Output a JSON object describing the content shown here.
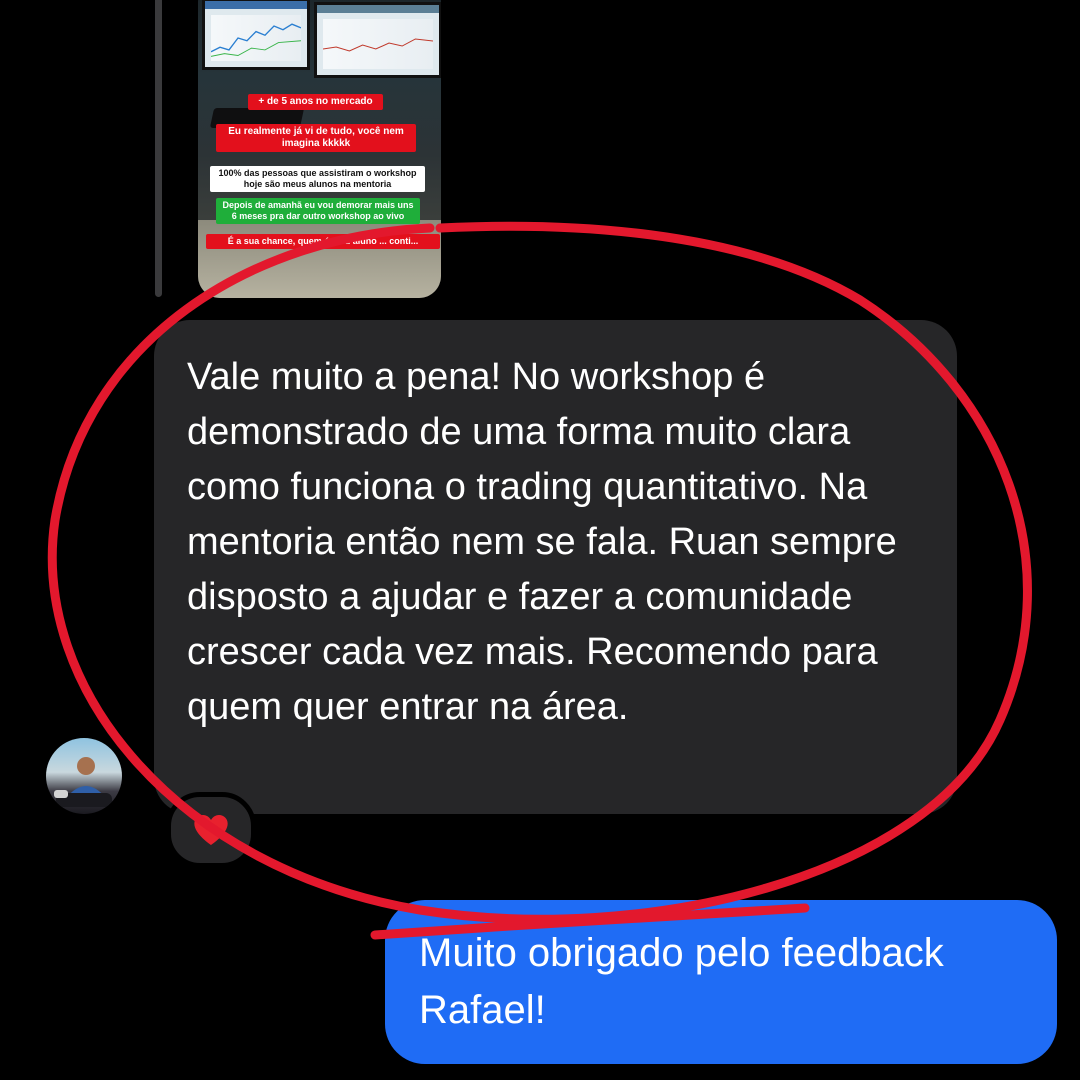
{
  "thread": {
    "story_preview": {
      "labels": [
        {
          "text": "+ de 5 anos no mercado",
          "style": "red"
        },
        {
          "text": "Eu realmente já vi de tudo, você nem imagina kkkkk",
          "style": "red"
        },
        {
          "text": "100% das pessoas que assistiram o workshop hoje são meus alunos na mentoria",
          "style": "white"
        },
        {
          "text": "Depois de amanhã eu vou demorar mais uns 6 meses pra dar outro workshop ao vivo",
          "style": "green"
        },
        {
          "text": "É a sua chance, quem é meu aluno ... conti...",
          "style": "red"
        }
      ]
    },
    "incoming_message": {
      "text": "Vale muito a pena! No workshop é demonstrado de uma forma muito clara como funciona o trading quantitativo. Na mentoria então nem se fala. Ruan sempre disposto a ajudar e fazer a comunidade crescer cada vez mais. Recomendo para quem quer entrar na área.",
      "reaction_icon": "red-heart-icon"
    },
    "outgoing_message": {
      "text": "Muito obrigado pelo feedback Rafael!"
    }
  },
  "colors": {
    "background": "#000000",
    "incoming_bubble": "#262628",
    "outgoing_bubble": "#1f6cf5",
    "annotation_circle": "#e3182d",
    "reaction_heart": "#e8212e"
  }
}
